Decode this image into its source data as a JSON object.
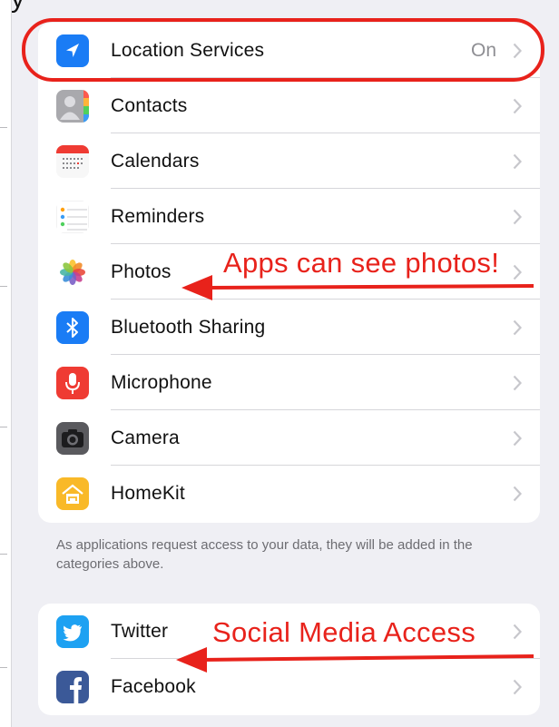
{
  "colors": {
    "annotation": "#e8221b",
    "background": "#efeff4",
    "separator": "#d6d6da",
    "secondary_text": "#8e8e93"
  },
  "top_partial_text": "y",
  "privacy_group": {
    "items": [
      {
        "label": "Location Services",
        "value": "On",
        "icon": "location-arrow-icon"
      },
      {
        "label": "Contacts",
        "icon": "contacts-icon"
      },
      {
        "label": "Calendars",
        "icon": "calendar-icon"
      },
      {
        "label": "Reminders",
        "icon": "reminders-icon"
      },
      {
        "label": "Photos",
        "icon": "photos-icon"
      },
      {
        "label": "Bluetooth Sharing",
        "icon": "bluetooth-icon"
      },
      {
        "label": "Microphone",
        "icon": "microphone-icon"
      },
      {
        "label": "Camera",
        "icon": "camera-icon"
      },
      {
        "label": "HomeKit",
        "icon": "homekit-icon"
      }
    ]
  },
  "footer_note": "As applications request access to your data, they will be added in the categories above.",
  "social_group": {
    "items": [
      {
        "label": "Twitter",
        "icon": "twitter-icon"
      },
      {
        "label": "Facebook",
        "icon": "facebook-icon"
      }
    ]
  },
  "annotations": {
    "photos": "Apps can see photos!",
    "social": "Social Media Access"
  }
}
